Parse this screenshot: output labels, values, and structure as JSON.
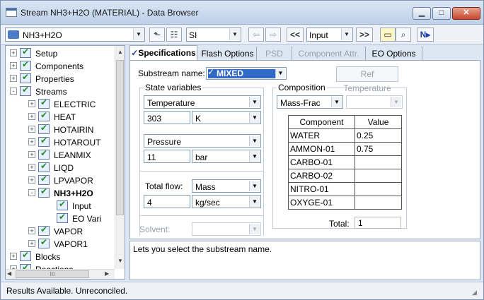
{
  "window": {
    "title": "Stream NH3+H2O (MATERIAL) - Data Browser"
  },
  "toolbar": {
    "selector_value": "NH3+H2O",
    "units": "SI",
    "prev_label": "<<",
    "form_value": "Input",
    "next_label": ">>",
    "next_icon": "N▸"
  },
  "tree": [
    {
      "label": "Setup",
      "level": 0,
      "exp": "+",
      "bold": false
    },
    {
      "label": "Components",
      "level": 0,
      "exp": "+",
      "bold": false
    },
    {
      "label": "Properties",
      "level": 0,
      "exp": "+",
      "bold": false
    },
    {
      "label": "Streams",
      "level": 0,
      "exp": "-",
      "bold": false
    },
    {
      "label": "ELECTRIC",
      "level": 1,
      "exp": "+",
      "bold": false
    },
    {
      "label": "HEAT",
      "level": 1,
      "exp": "+",
      "bold": false
    },
    {
      "label": "HOTAIRIN",
      "level": 1,
      "exp": "+",
      "bold": false
    },
    {
      "label": "HOTAROUT",
      "level": 1,
      "exp": "+",
      "bold": false
    },
    {
      "label": "LEANMIX",
      "level": 1,
      "exp": "+",
      "bold": false
    },
    {
      "label": "LIQD",
      "level": 1,
      "exp": "+",
      "bold": false
    },
    {
      "label": "LPVAPOR",
      "level": 1,
      "exp": "+",
      "bold": false
    },
    {
      "label": "NH3+H2O",
      "level": 1,
      "exp": "-",
      "bold": true
    },
    {
      "label": "Input",
      "level": 2,
      "exp": "",
      "bold": false
    },
    {
      "label": "EO Vari",
      "level": 2,
      "exp": "",
      "bold": false
    },
    {
      "label": "VAPOR",
      "level": 1,
      "exp": "+",
      "bold": false
    },
    {
      "label": "VAPOR1",
      "level": 1,
      "exp": "+",
      "bold": false
    },
    {
      "label": "Blocks",
      "level": 0,
      "exp": "+",
      "bold": false
    },
    {
      "label": "Reactions",
      "level": 0,
      "exp": "+",
      "bold": false
    }
  ],
  "tree_hscroll_label": "III",
  "tabs": [
    {
      "label": "Specifications",
      "active": true,
      "disabled": false
    },
    {
      "label": "Flash Options",
      "active": false,
      "disabled": false
    },
    {
      "label": "PSD",
      "active": false,
      "disabled": true
    },
    {
      "label": "Component Attr.",
      "active": false,
      "disabled": true
    },
    {
      "label": "EO Options",
      "active": false,
      "disabled": false
    }
  ],
  "spec": {
    "substream_label": "Substream name:",
    "substream_value": "MIXED",
    "ref_temp_button": "Ref Temperature",
    "state_vars_title": "State variables",
    "var1_name": "Temperature",
    "var1_value": "303",
    "var1_unit": "K",
    "var2_name": "Pressure",
    "var2_value": "11",
    "var2_unit": "bar",
    "total_flow_label": "Total flow:",
    "total_flow_basis": "Mass",
    "total_flow_value": "4",
    "total_flow_unit": "kg/sec",
    "solvent_label": "Solvent:",
    "composition_title": "Composition",
    "comp_basis": "Mass-Frac",
    "table_headers": [
      "Component",
      "Value"
    ],
    "components": [
      {
        "name": "WATER",
        "value": "0.25"
      },
      {
        "name": "AMMON-01",
        "value": "0.75"
      },
      {
        "name": "CARBO-01",
        "value": ""
      },
      {
        "name": "CARBO-02",
        "value": ""
      },
      {
        "name": "NITRO-01",
        "value": ""
      },
      {
        "name": "OXYGE-01",
        "value": ""
      }
    ],
    "total_label": "Total:",
    "total_value": "1"
  },
  "help_text": "Lets you select the substream name.",
  "status_text": "Results Available. Unreconciled.",
  "colors": {
    "accent": "#3169c6",
    "check": "#1e8c2a",
    "close": "#c9452c"
  }
}
